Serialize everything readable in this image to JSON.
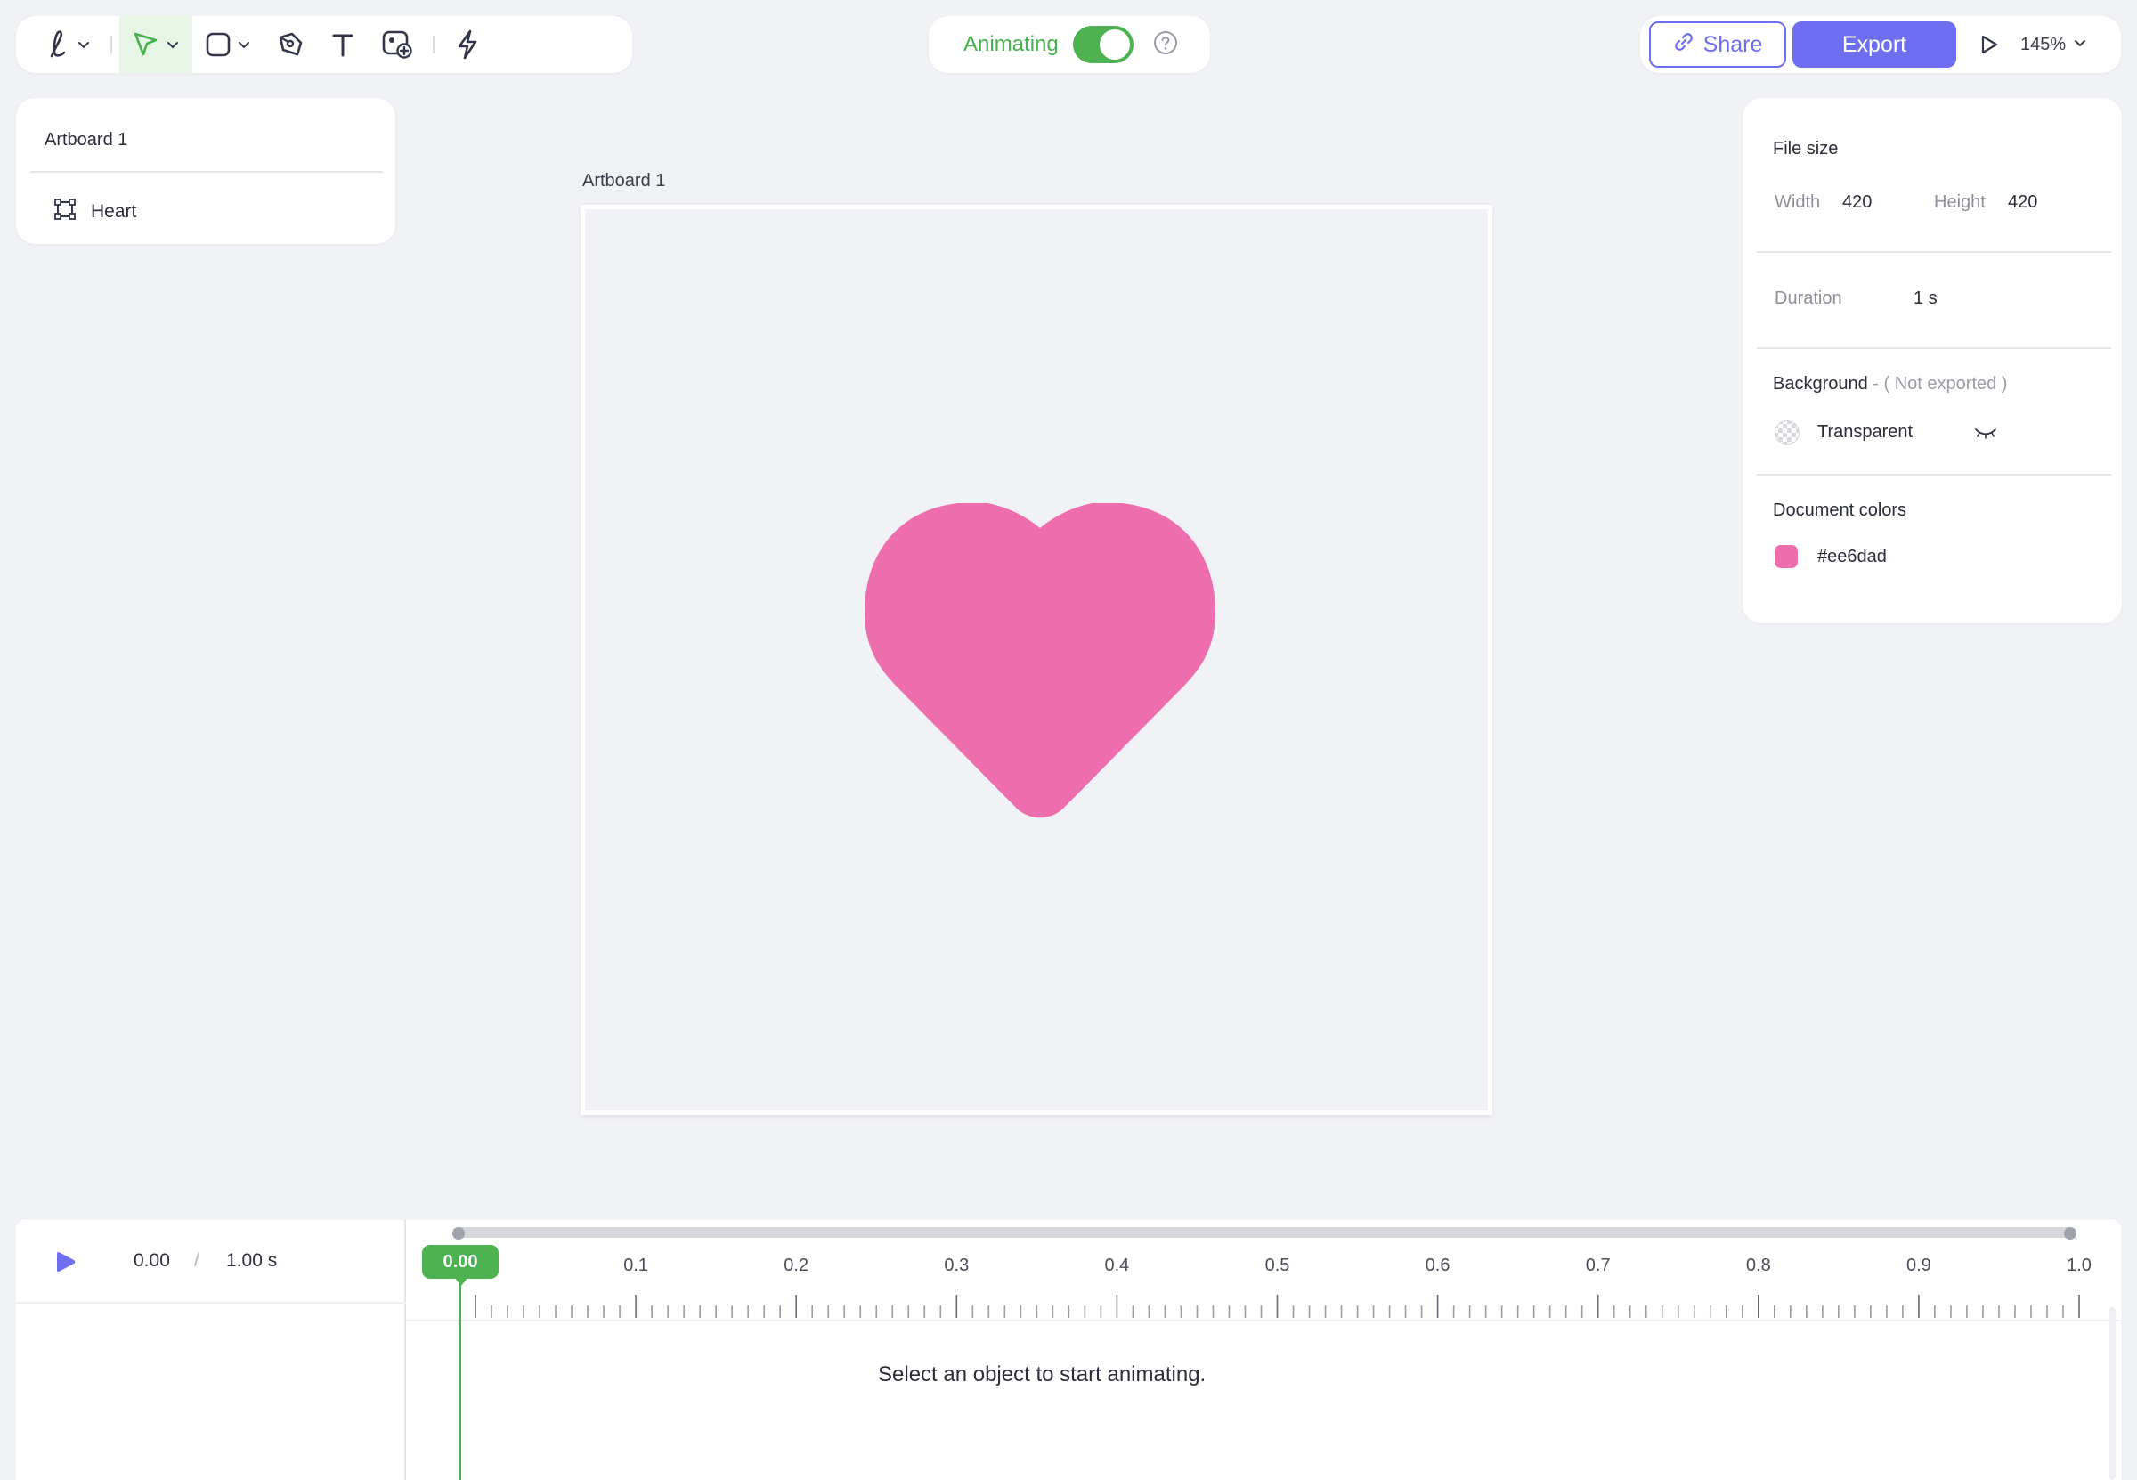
{
  "toolbar": {
    "tools": [
      {
        "name": "freehand-tool",
        "icon": "freehand-icon",
        "has_menu": true
      },
      {
        "name": "select-tool",
        "icon": "cursor-icon",
        "has_menu": true,
        "active": true
      },
      {
        "name": "shape-tool",
        "icon": "rectangle-icon",
        "has_menu": true
      },
      {
        "name": "pen-tool",
        "icon": "pen-icon"
      },
      {
        "name": "text-tool",
        "icon": "text-icon"
      },
      {
        "name": "image-tool",
        "icon": "image-add-icon"
      },
      {
        "name": "lightning-tool",
        "icon": "lightning-icon"
      }
    ]
  },
  "animating": {
    "label": "Animating",
    "enabled": true
  },
  "actions": {
    "share_label": "Share",
    "export_label": "Export",
    "zoom": "145%"
  },
  "layers": {
    "title": "Artboard 1",
    "items": [
      {
        "label": "Heart",
        "icon": "frame-icon"
      }
    ]
  },
  "artboard": {
    "label": "Artboard 1",
    "shape_color": "#ee6dad"
  },
  "properties": {
    "file_size_title": "File size",
    "width_label": "Width",
    "width_value": "420",
    "height_label": "Height",
    "height_value": "420",
    "duration_label": "Duration",
    "duration_value": "1 s",
    "background_title": "Background",
    "background_note": " - ( Not exported )",
    "background_value": "Transparent",
    "document_colors_title": "Document colors",
    "document_colors": [
      "#ee6dad"
    ]
  },
  "timeline": {
    "current_time": "0.00",
    "separator": "/",
    "total_time": "1.00 s",
    "playhead": "0.00",
    "ruler_labels": [
      "0.1",
      "0.2",
      "0.3",
      "0.4",
      "0.5",
      "0.6",
      "0.7",
      "0.8",
      "0.9",
      "1.0"
    ],
    "empty_message": "Select an object to start animating."
  },
  "colors": {
    "accent": "#6d6ef0",
    "success": "#4cb350",
    "heart": "#ee6dad"
  }
}
